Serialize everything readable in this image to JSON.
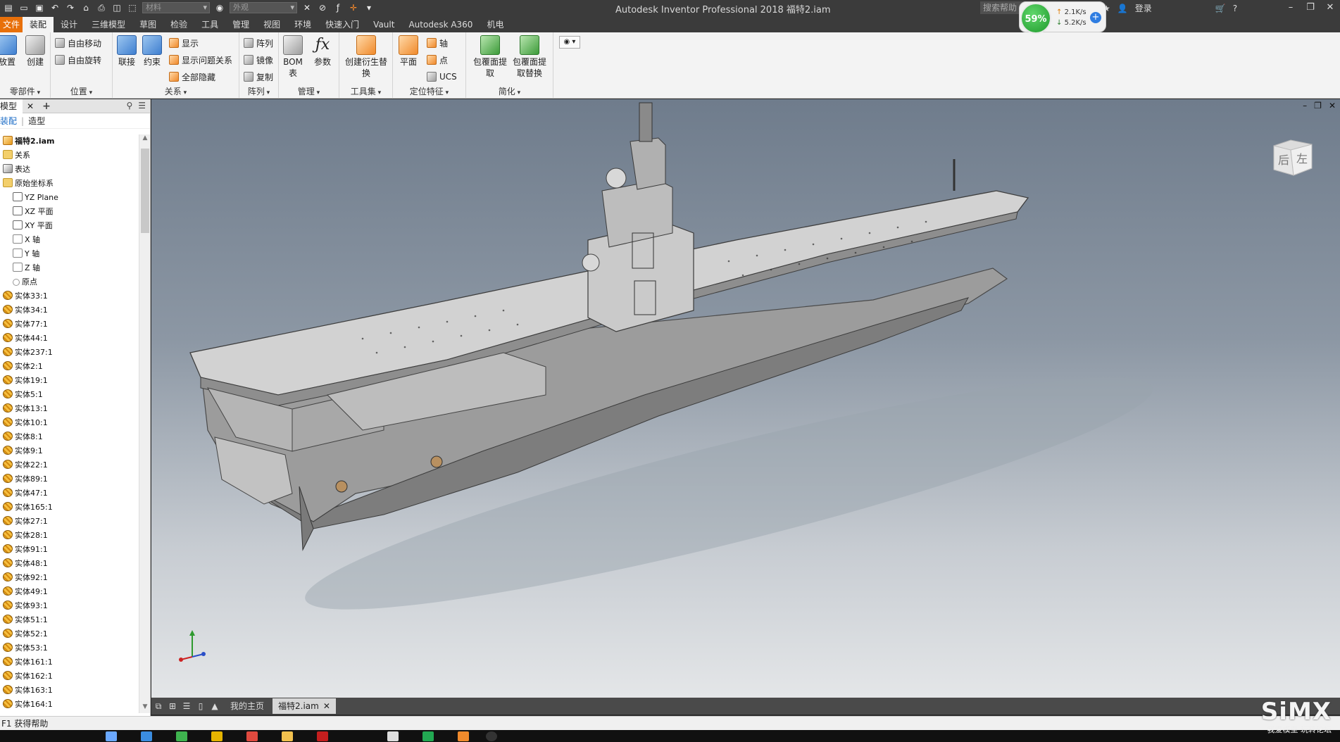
{
  "title_bar": {
    "title": "Autodesk Inventor Professional 2018    福特2.iam",
    "combo1": "材料",
    "combo2": "外观",
    "search_placeholder": "搜索帮助",
    "login": "登录"
  },
  "net_widget": {
    "percent": "59%",
    "up": "2.1K/s",
    "down": "5.2K/s"
  },
  "tabs": [
    "文件",
    "装配",
    "设计",
    "三维模型",
    "草图",
    "检验",
    "工具",
    "管理",
    "视图",
    "环境",
    "快速入门",
    "Vault",
    "Autodesk A360",
    "机电"
  ],
  "active_tab": "装配",
  "ribbon": {
    "components": {
      "title": "零部件",
      "place": "放置",
      "create": "创建"
    },
    "position": {
      "title": "位置",
      "free_move": "自由移动",
      "free_rotate": "自由旋转"
    },
    "relationships": {
      "title": "关系",
      "joint": "联接",
      "constrain": "约束",
      "show": "显示",
      "show_problem": "显示问题关系",
      "hide_all": "全部隐藏"
    },
    "pattern": {
      "title": "阵列",
      "pattern": "阵列",
      "mirror": "镜像",
      "copy": "复制"
    },
    "manage": {
      "title": "管理",
      "bom": "BOM表",
      "params": "参数"
    },
    "workspace": {
      "title": "工具集",
      "derive": "创建衍生替换"
    },
    "work_features": {
      "title": "定位特征",
      "plane": "平面",
      "axis": "轴",
      "point": "点",
      "ucs": "UCS"
    },
    "simplify": {
      "title": "简化",
      "shrinkwrap": "包覆面提取",
      "shrinkwrap_sub": "包覆面提取替换"
    }
  },
  "browser": {
    "tab_label": "模型",
    "mode_assembly": "装配",
    "mode_modeling": "造型",
    "root": "福特2.iam",
    "top_nodes": [
      {
        "label": "关系",
        "icon": "folder"
      },
      {
        "label": "表达",
        "icon": "rep"
      },
      {
        "label": "原始坐标系",
        "icon": "folder"
      }
    ],
    "origin_nodes": [
      {
        "label": "YZ Plane",
        "icon": "plane"
      },
      {
        "label": "XZ 平面",
        "icon": "plane"
      },
      {
        "label": "XY 平面",
        "icon": "plane"
      },
      {
        "label": "X 轴",
        "icon": "axis"
      },
      {
        "label": "Y 轴",
        "icon": "axis"
      },
      {
        "label": "Z 轴",
        "icon": "axis"
      },
      {
        "label": "原点",
        "icon": "point"
      }
    ],
    "parts": [
      "实体33:1",
      "实体34:1",
      "实体77:1",
      "实体44:1",
      "实体237:1",
      "实体2:1",
      "实体19:1",
      "实体5:1",
      "实体13:1",
      "实体10:1",
      "实体8:1",
      "实体9:1",
      "实体22:1",
      "实体89:1",
      "实体47:1",
      "实体165:1",
      "实体27:1",
      "实体28:1",
      "实体91:1",
      "实体48:1",
      "实体92:1",
      "实体49:1",
      "实体93:1",
      "实体51:1",
      "实体52:1",
      "实体53:1",
      "实体161:1",
      "实体162:1",
      "实体163:1",
      "实体164:1"
    ]
  },
  "viewcube": {
    "face1": "后",
    "face2": "左"
  },
  "doc_tabs": {
    "home": "我的主页",
    "active": "福特2.iam"
  },
  "status": "F1 获得帮助",
  "watermark": {
    "logo": "SiMX",
    "sub": "我爱模型 玩转论坛"
  },
  "colors": {
    "accent": "#e8700a",
    "titlebar": "#3b3b3b",
    "ribbon": "#f3f3f3"
  }
}
